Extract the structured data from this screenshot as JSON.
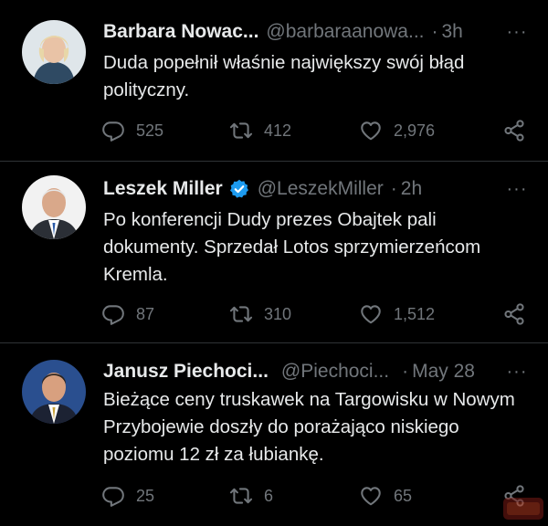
{
  "colors": {
    "background": "#000000",
    "text": "#e7e9ea",
    "muted": "#71767b",
    "divider": "#2f3336",
    "verified": "#1d9bf0"
  },
  "tweets": [
    {
      "name": "Barbara Nowac...",
      "handle": "@barbaraanowa...",
      "dot": "·",
      "time": "3h",
      "verified": false,
      "more": "···",
      "text": "Duda popełnił właśnie największy swój błąd polityczny.",
      "replies": "525",
      "retweets": "412",
      "likes": "2,976"
    },
    {
      "name": "Leszek Miller",
      "handle": "@LeszekMiller",
      "dot": "·",
      "time": "2h",
      "verified": true,
      "more": "···",
      "text": "Po konferencji Dudy prezes Obajtek pali dokumenty. Sprzedał Lotos sprzymierzeńcom Kremla.",
      "replies": "87",
      "retweets": "310",
      "likes": "1,512"
    },
    {
      "name": "Janusz Piechoci...",
      "handle": "@Piechoci...",
      "dot": "·",
      "time": "May 28",
      "verified": false,
      "more": "···",
      "text": "Bieżące ceny truskawek na Targowisku w Nowym Przybojewie doszły do porażająco niskiego poziomu 12 zł za łubiankę.",
      "replies": "25",
      "retweets": "6",
      "likes": "65"
    }
  ],
  "icons": {
    "reply": "reply-icon",
    "retweet": "retweet-icon",
    "like": "heart-icon",
    "share": "share-icon",
    "verified": "verified-badge-icon",
    "more": "more-options-icon"
  }
}
